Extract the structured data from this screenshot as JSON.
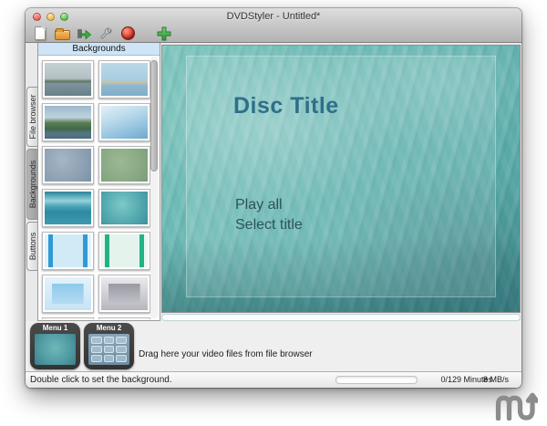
{
  "window": {
    "title": "DVDStyler - Untitled*"
  },
  "toolbar": {
    "buttons": [
      {
        "name": "new-project",
        "icon": "new-document-icon"
      },
      {
        "name": "open-project",
        "icon": "open-folder-icon"
      },
      {
        "name": "save-project",
        "icon": "green-arrow-save-icon"
      },
      {
        "name": "settings",
        "icon": "wrench-icon"
      },
      {
        "name": "burn-dvd",
        "icon": "burn-disc-icon"
      },
      {
        "name": "add-file",
        "icon": "plus-icon"
      }
    ]
  },
  "sidebar": {
    "tabs": [
      {
        "label": "File browser",
        "selected": false
      },
      {
        "label": "Backgrounds",
        "selected": true
      },
      {
        "label": "Buttons",
        "selected": false
      }
    ]
  },
  "backgrounds_panel": {
    "header": "Backgrounds",
    "thumbnails": [
      {
        "name": "harbor-photo",
        "style": "linear-gradient(180deg,#c6d0d2 0%,#b2c0c5 48%,#62745f 56%,#7e939b 63%,#68808a 100%)"
      },
      {
        "name": "coast-photo",
        "style": "linear-gradient(180deg,#bcd8e8 0%,#a8cde2 52%,#c9c0a0 60%,#8fb8cf 68%,#7fafc9 100%)"
      },
      {
        "name": "river-photo",
        "style": "linear-gradient(180deg,#9db8cc 0%,#bdd2de 35%,#5c7d52 52%,#3f6a4a 70%,#567686 85%,#496a7e 100%)"
      },
      {
        "name": "blue-gradient",
        "style": "linear-gradient(160deg,#e2f0f8 0%,#b8d8ea 40%,#8fc0dd 72%,#6fa9cc 100%)"
      },
      {
        "name": "slate-clouds",
        "style": "radial-gradient(circle at 38% 35%,#a6b6c4 0%,#8fa3b5 55%,#7b92a6 100%)"
      },
      {
        "name": "green-clouds",
        "style": "radial-gradient(circle at 42% 40%,#9cb894 0%,#8aab85 55%,#7a9c78 100%)"
      },
      {
        "name": "teal-bands",
        "style": "linear-gradient(180deg,#2e7f96 0%,#63b2c2 16%,#95d2da 28%,#49a2b4 46%,#2e8aa0 62%,#3e9ab0 100%)"
      },
      {
        "name": "turquoise-clouds",
        "style": "radial-gradient(circle at 45% 40%,#7ec8c8 0%,#55aab0 55%,#3d8f9c 100%)"
      },
      {
        "name": "blue-bars",
        "style": "linear-gradient(90deg,#e2f1fa 0%,#e2f1fa 8%,#2e9ad6 8%,#2e9ad6 18%,#d2eaf6 18%,#d2eaf6 82%,#2e9ad6 82%,#2e9ad6 92%,#e2f1fa 92%,#e2f1fa 100%)"
      },
      {
        "name": "green-bars",
        "style": "linear-gradient(90deg,#eaf7f0 0%,#eaf7f0 8%,#22b384 8%,#22b384 18%,#e4f4ec 18%,#e4f4ec 82%,#22b384 82%,#22b384 92%,#eaf7f0 92%,#eaf7f0 100%)"
      },
      {
        "name": "blue-frame",
        "style": "linear-gradient(180deg,#8ec9ea 0%,#b4dcf2 100%) center / 68% 62% no-repeat, linear-gradient(180deg,#e4f2fa 0%,#c6e3f5 100%)"
      },
      {
        "name": "silver-frame",
        "style": "linear-gradient(180deg,#9a9aa2 0%,#c2c2ca 100%) center / 68% 62% no-repeat, linear-gradient(180deg,#eaeaee 0%,#b6b6be 100%)"
      },
      {
        "name": "gold-gradient",
        "style": "linear-gradient(180deg,#f5e9b0 0%,#d8b93e 40%,#a8831a 70%,#e8d06a 100%)"
      },
      {
        "name": "taupe-gradient",
        "style": "linear-gradient(180deg,#d8d4d0 0%,#b0a8a2 55%,#8f8680 100%)"
      }
    ]
  },
  "canvas": {
    "disc_title": "Disc Title",
    "buttons": [
      "Play all",
      "Select title"
    ],
    "colors": {
      "base_teal": "#5fb2ae",
      "title_text": "#2e6f8a",
      "button_text": "#2d525c"
    }
  },
  "menus": [
    {
      "label": "Menu 1",
      "style": "radial-gradient(circle at 50% 45%,#6fb8b8 0%,#4f9aa2 60%,#3a7e8a 100%)",
      "grid": false
    },
    {
      "label": "Menu 2",
      "style": "linear-gradient(180deg,#8aa6b8,#6f8ca0)",
      "grid": true
    }
  ],
  "dropzone": {
    "text": "Drag here your video files from file browser"
  },
  "statusbar": {
    "hint": "Double click to set the background.",
    "minutes": "0/129 Minutes",
    "speed": "8 MB/s"
  },
  "watermark": {
    "name": "macupdate-logo"
  }
}
